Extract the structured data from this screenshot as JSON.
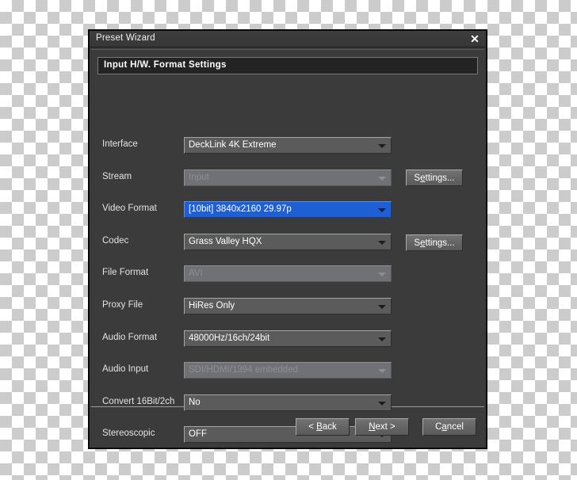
{
  "window": {
    "title": "Preset Wizard",
    "close_icon": "close-icon",
    "close_glyph": "✕"
  },
  "section": {
    "header": "Input H/W. Format Settings"
  },
  "fields": [
    {
      "label": "Interface",
      "value": "DeckLink 4K Extreme",
      "state": "normal",
      "settings_button": null
    },
    {
      "label": "Stream",
      "value": "Input",
      "state": "disabled",
      "settings_button": "Settings..."
    },
    {
      "label": "Video Format",
      "value": "[10bit] 3840x2160 29.97p",
      "state": "selected",
      "settings_button": null
    },
    {
      "label": "Codec",
      "value": "Grass Valley HQX",
      "state": "normal",
      "settings_button": "Settings..."
    },
    {
      "label": "File Format",
      "value": "AVI",
      "state": "disabled",
      "settings_button": null
    },
    {
      "label": "Proxy File",
      "value": "HiRes Only",
      "state": "normal",
      "settings_button": null
    },
    {
      "label": "Audio Format",
      "value": "48000Hz/16ch/24bit",
      "state": "normal",
      "settings_button": null
    },
    {
      "label": "Audio Input",
      "value": "SDI/HDMI/1394 embedded",
      "state": "disabled",
      "settings_button": null
    },
    {
      "label": "Convert 16Bit/2ch",
      "value": "No",
      "state": "normal",
      "settings_button": null
    },
    {
      "label": "Stereoscopic",
      "value": "OFF",
      "state": "normal",
      "settings_button": null
    }
  ],
  "settings_buttons": {
    "stream": {
      "prefix": "S",
      "accel": "e",
      "suffix": "ttings..."
    },
    "codec": {
      "prefix": "S",
      "accel": "e",
      "suffix": "ttings..."
    }
  },
  "footer": {
    "back": {
      "prefix": "< ",
      "accel": "B",
      "suffix": "ack"
    },
    "next": {
      "prefix": "",
      "accel": "N",
      "suffix": "ext >"
    },
    "cancel": {
      "prefix": "C",
      "accel": "a",
      "suffix": "ncel"
    }
  },
  "colors": {
    "dialog_bg": "#3b3b3b",
    "titlebar_bg": "#3a3a3a",
    "header_bg": "#232323",
    "combo_bg": "#5b5b5b",
    "combo_disabled_bg": "#6f7174",
    "combo_selected_bg": "#1f5fd4",
    "text": "#ffffff",
    "text_disabled": "#8c8f93"
  }
}
